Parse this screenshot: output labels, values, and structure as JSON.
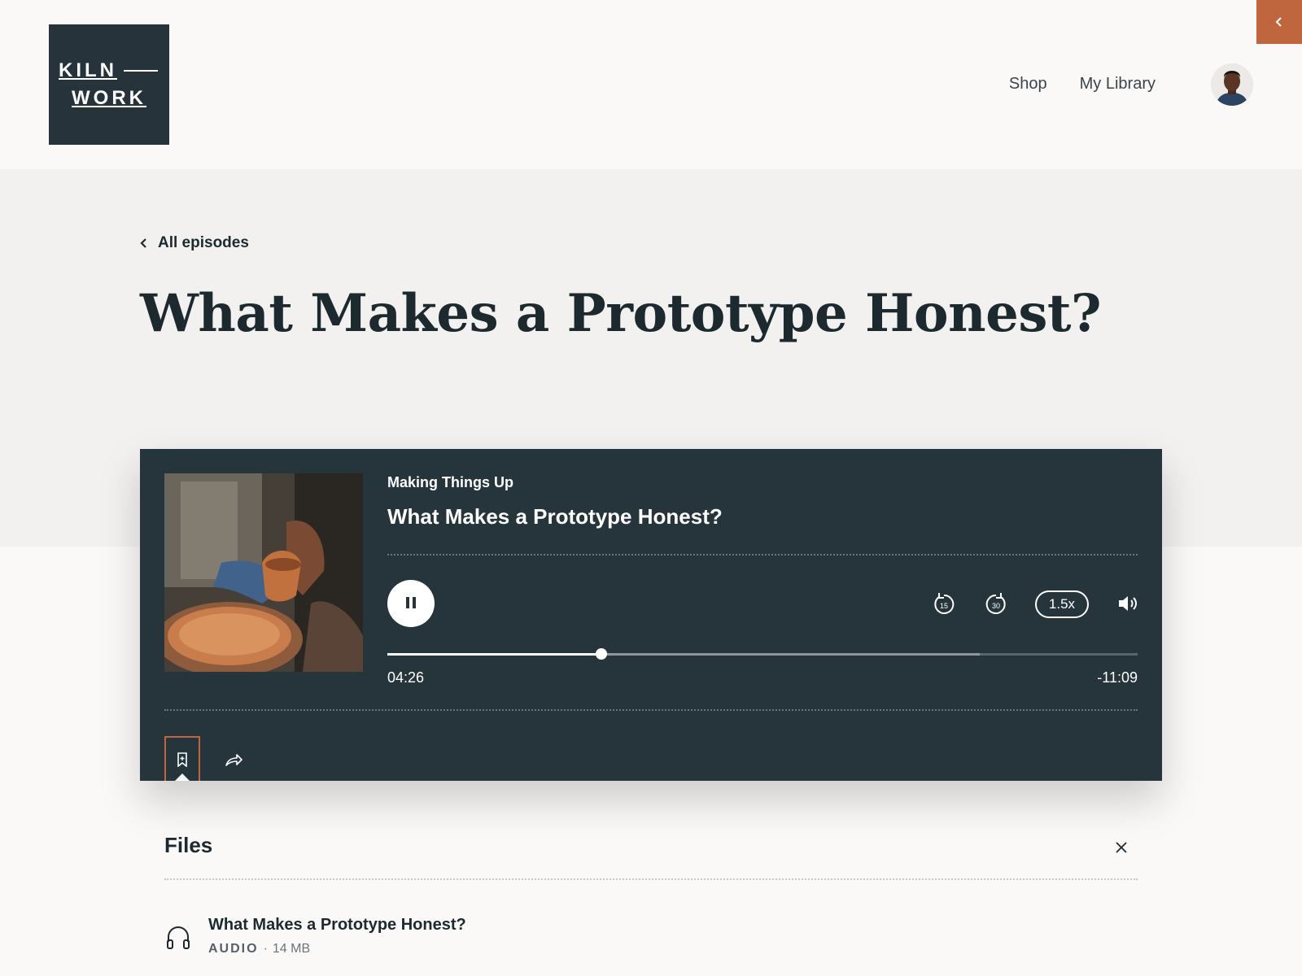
{
  "header": {
    "logo_line1": "KILN",
    "logo_line2": "WORK",
    "nav": [
      "Shop",
      "My Library"
    ],
    "collapse_icon": "chevron-left-icon"
  },
  "hero": {
    "back_label": "All episodes",
    "title": "What Makes a Prototype Honest?"
  },
  "player": {
    "show_name": "Making Things Up",
    "episode_title": "What Makes a Prototype Honest?",
    "speed": "1.5x",
    "elapsed": "04:26",
    "remaining": "-11:09",
    "progress_fraction": 0.285,
    "buffered_fraction": 0.79,
    "state": "playing",
    "skip_back_seconds": "15",
    "skip_forward_seconds": "30",
    "active_tab": "bookmark"
  },
  "files": {
    "heading": "Files",
    "items": [
      {
        "name": "What Makes a Prototype Honest?",
        "type": "AUDIO",
        "size": "14 MB",
        "icon": "headphones-icon"
      }
    ]
  },
  "colors": {
    "accent": "#c0663e",
    "player_bg": "#26343b",
    "logo_bg": "#26333a"
  }
}
